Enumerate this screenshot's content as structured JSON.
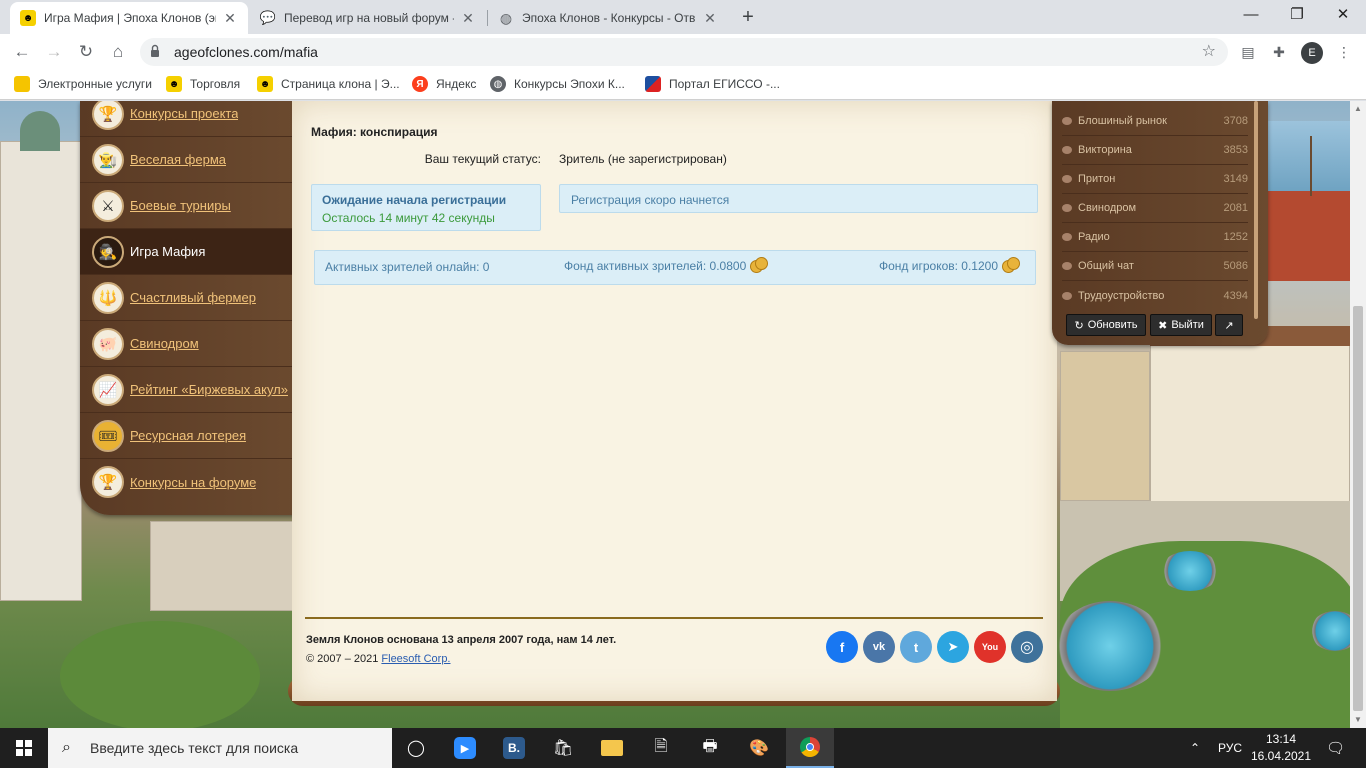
{
  "browser": {
    "tabs": [
      {
        "title": "Игра Мафия | Эпоха Клонов (эк",
        "active": true,
        "favicon": "clone-logo-icon"
      },
      {
        "title": "Перевод игр на новый форум -",
        "active": false,
        "favicon": "speech-bubble-icon"
      },
      {
        "title": "Эпоха Клонов - Конкурсы - Отв",
        "active": false,
        "favicon": "globe-icon"
      }
    ],
    "new_tab": "+",
    "url": "ageofclones.com/mafia",
    "profile_initial": "E",
    "bookmarks": [
      {
        "label": "Электронные услуги"
      },
      {
        "label": "Торговля"
      },
      {
        "label": "Страница клона | Э..."
      },
      {
        "label": "Яндекс"
      },
      {
        "label": "Конкурсы Эпохи К..."
      },
      {
        "label": "Портал ЕГИССО -..."
      }
    ]
  },
  "left_menu": {
    "items": [
      {
        "label": "Конкурсы проекта",
        "icon": "trophy-icon",
        "active": false
      },
      {
        "label": "Веселая ферма",
        "icon": "farmer-icon",
        "active": false
      },
      {
        "label": "Боевые турниры",
        "icon": "fighter-icon",
        "active": false
      },
      {
        "label": "Игра Мафия",
        "icon": "mafia-icon",
        "active": true
      },
      {
        "label": "Счастливый фермер",
        "icon": "pitchfork-icon",
        "active": false
      },
      {
        "label": "Свинодром",
        "icon": "pig-race-icon",
        "active": false
      },
      {
        "label": "Рейтинг «Биржевых акул»",
        "icon": "chart-icon",
        "active": false
      },
      {
        "label": "Ресурсная лотерея",
        "icon": "lottery-icon",
        "active": false
      },
      {
        "label": "Конкурсы на форуме",
        "icon": "trophy-icon",
        "active": false
      }
    ]
  },
  "mafia": {
    "title": "Мафия: конспирация",
    "status_label": "Ваш текущий статус:",
    "status_value": "Зритель (не зарегистрирован)",
    "wait_title": "Ожидание начала регистрации",
    "wait_remaining": "Осталось 14 минут 42 секунды",
    "registration_note": "Регистрация скоро начнется",
    "viewers_online": "Активных зрителей онлайн: 0",
    "viewers_fund": "Фонд активных зрителей: 0.0800",
    "players_fund": "Фонд игроков: 0.1200"
  },
  "footer": {
    "founded": "Земля Клонов основана 13 апреля 2007 года, нам 14 лет.",
    "copyright": "© 2007 – 2021",
    "company": "Fleesoft Corp.",
    "social": [
      {
        "name": "facebook-icon",
        "glyph": "f",
        "color": "#1877f2"
      },
      {
        "name": "vk-icon",
        "glyph": "vk",
        "color": "#4a76a8"
      },
      {
        "name": "twitter-icon",
        "glyph": "t",
        "color": "#5fa8dc"
      },
      {
        "name": "telegram-icon",
        "glyph": "➤",
        "color": "#2ca5e0"
      },
      {
        "name": "youtube-icon",
        "glyph": "You",
        "color": "#e0322a"
      },
      {
        "name": "instagram-icon",
        "glyph": "◎",
        "color": "#3f729b"
      }
    ]
  },
  "right_panel": {
    "rooms": [
      {
        "name": "Блошиный рынок",
        "count": "3708"
      },
      {
        "name": "Викторина",
        "count": "3853"
      },
      {
        "name": "Притон",
        "count": "3149"
      },
      {
        "name": "Свинодром",
        "count": "2081"
      },
      {
        "name": "Радио",
        "count": "1252"
      },
      {
        "name": "Общий чат",
        "count": "5086"
      },
      {
        "name": "Трудоустройство",
        "count": "4394"
      }
    ],
    "refresh_label": "Обновить",
    "logout_label": "Выйти"
  },
  "taskbar": {
    "search_placeholder": "Введите здесь текст для поиска",
    "language": "РУС",
    "time": "13:14",
    "date": "16.04.2021"
  },
  "colors": {
    "menu_link": "#f0c27a",
    "info_blue": "#4a7fa5",
    "timer_green": "#3b9a3b",
    "parchment": "#f9f3e3"
  }
}
